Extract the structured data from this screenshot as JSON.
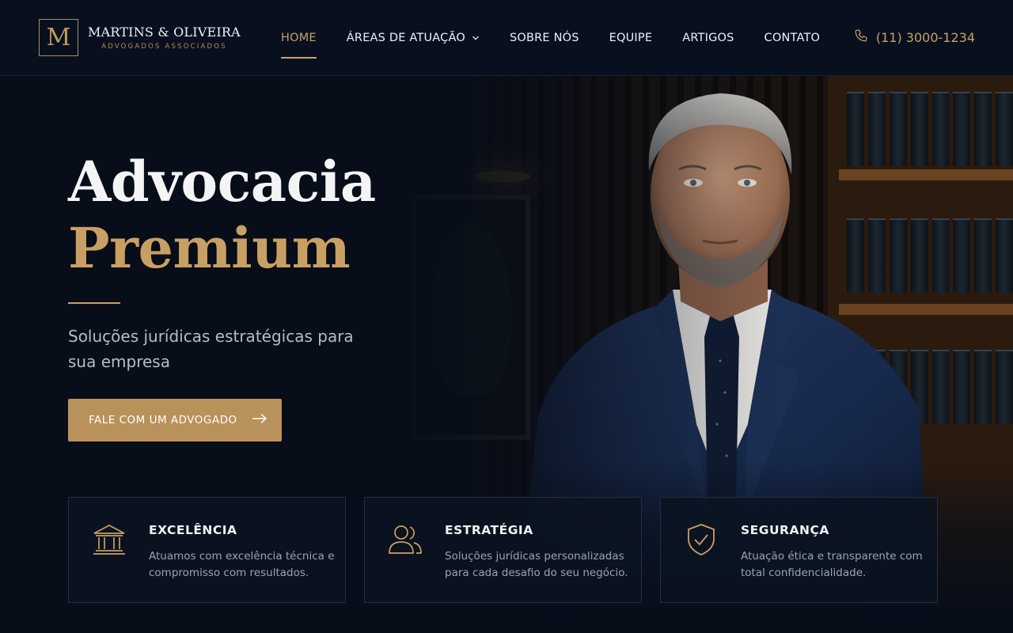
{
  "brand": {
    "monogram": "M",
    "name": "MARTINS & OLIVEIRA",
    "tagline": "ADVOGADOS ASSOCIADOS"
  },
  "nav": {
    "items": [
      {
        "label": "HOME",
        "active": true
      },
      {
        "label": "ÁREAS DE ATUAÇÃO",
        "has_dropdown": true
      },
      {
        "label": "SOBRE NÓS"
      },
      {
        "label": "EQUIPE"
      },
      {
        "label": "ARTIGOS"
      },
      {
        "label": "CONTATO"
      }
    ],
    "phone": "(11) 3000-1234"
  },
  "hero": {
    "title": "Advocacia",
    "title_accent": "Premium",
    "subtitle": "Soluções jurídicas estratégicas para sua empresa",
    "cta_label": "FALE COM UM ADVOGADO"
  },
  "features": [
    {
      "icon": "courthouse-icon",
      "title": "EXCELÊNCIA",
      "text": "Atuamos com excelência técnica e compromisso com resultados."
    },
    {
      "icon": "users-icon",
      "title": "ESTRATÉGIA",
      "text": "Soluções jurídicas personalizadas para cada desafio do seu negócio."
    },
    {
      "icon": "shield-check-icon",
      "title": "SEGURANÇA",
      "text": "Atuação ética e transparente com total confidencialidade."
    }
  ],
  "colors": {
    "background": "#070d19",
    "accent_gold": "#c9a063",
    "button_gold": "#b8925a",
    "text_muted": "#9ea3ad"
  }
}
